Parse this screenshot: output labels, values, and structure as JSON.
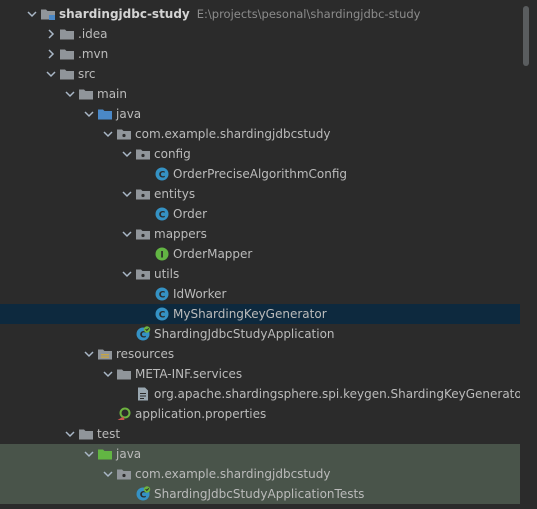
{
  "project": {
    "name": "shardingjdbc-study",
    "path": "E:\\projects\\pesonal\\shardingjdbc-study"
  },
  "tree": [
    {
      "label": "shardingjdbc-study",
      "path": "E:\\projects\\pesonal\\shardingjdbc-study",
      "depth": 0,
      "expanded": true,
      "icon": "module-folder-icon",
      "bold": true
    },
    {
      "label": ".idea",
      "depth": 1,
      "expanded": false,
      "icon": "folder-icon"
    },
    {
      "label": ".mvn",
      "depth": 1,
      "expanded": false,
      "icon": "folder-icon"
    },
    {
      "label": "src",
      "depth": 1,
      "expanded": true,
      "icon": "folder-icon"
    },
    {
      "label": "main",
      "depth": 2,
      "expanded": true,
      "icon": "folder-icon"
    },
    {
      "label": "java",
      "depth": 3,
      "expanded": true,
      "icon": "source-root-icon"
    },
    {
      "label": "com.example.shardingjdbcstudy",
      "depth": 4,
      "expanded": true,
      "icon": "package-icon"
    },
    {
      "label": "config",
      "depth": 5,
      "expanded": true,
      "icon": "package-icon"
    },
    {
      "label": "OrderPreciseAlgorithmConfig",
      "depth": 6,
      "icon": "class-icon"
    },
    {
      "label": "entitys",
      "depth": 5,
      "expanded": true,
      "icon": "package-icon"
    },
    {
      "label": "Order",
      "depth": 6,
      "icon": "class-icon"
    },
    {
      "label": "mappers",
      "depth": 5,
      "expanded": true,
      "icon": "package-icon"
    },
    {
      "label": "OrderMapper",
      "depth": 6,
      "icon": "interface-icon"
    },
    {
      "label": "utils",
      "depth": 5,
      "expanded": true,
      "icon": "package-icon"
    },
    {
      "label": "IdWorker",
      "depth": 6,
      "icon": "class-icon"
    },
    {
      "label": "MyShardingKeyGenerator",
      "depth": 6,
      "icon": "class-icon",
      "selected": true
    },
    {
      "label": "ShardingJdbcStudyApplication",
      "depth": 5,
      "icon": "spring-boot-class-icon"
    },
    {
      "label": "resources",
      "depth": 3,
      "expanded": true,
      "icon": "resources-root-icon"
    },
    {
      "label": "META-INF.services",
      "depth": 4,
      "expanded": true,
      "icon": "folder-icon"
    },
    {
      "label": "org.apache.shardingsphere.spi.keygen.ShardingKeyGenerator",
      "depth": 5,
      "icon": "text-file-icon"
    },
    {
      "label": "application.properties",
      "depth": 4,
      "icon": "properties-file-icon"
    },
    {
      "label": "test",
      "depth": 2,
      "expanded": true,
      "icon": "folder-icon"
    },
    {
      "label": "java",
      "depth": 3,
      "expanded": true,
      "icon": "test-root-icon",
      "test": true
    },
    {
      "label": "com.example.shardingjdbcstudy",
      "depth": 4,
      "expanded": true,
      "icon": "package-icon",
      "test": true
    },
    {
      "label": "ShardingJdbcStudyApplicationTests",
      "depth": 5,
      "icon": "spring-boot-class-icon",
      "test": true
    }
  ],
  "colors": {
    "background": "#2b2b2b",
    "selection": "#0d293e",
    "test_highlight": "#49544a",
    "text": "#bbbbbb",
    "path_text": "#8c8c8c",
    "folder": "#90959a",
    "source_folder": "#4a88c7",
    "test_folder": "#62b543",
    "class_icon": "#3592c4",
    "interface_icon": "#62b543",
    "spring": "#6db33f"
  }
}
